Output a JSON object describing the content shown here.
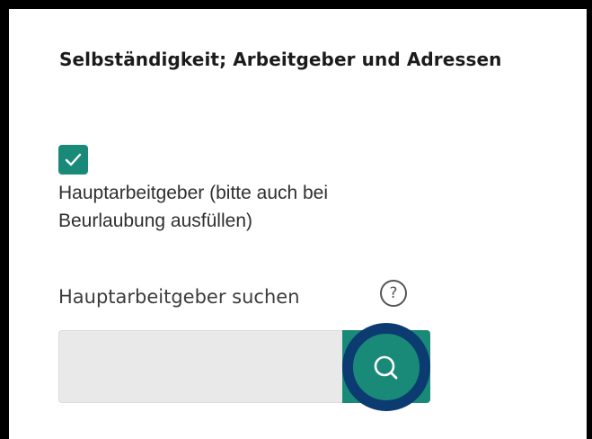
{
  "section": {
    "title": "Selbständigkeit; Arbeitgeber und Adressen"
  },
  "main_employer_checkbox": {
    "checked": true,
    "label": "Hauptarbeitgeber (bitte auch bei Beurlaubung ausfüllen)"
  },
  "employer_search": {
    "label": "Hauptarbeitgeber suchen",
    "help_symbol": "?",
    "input_value": "",
    "button_icon": "search-icon"
  },
  "colors": {
    "accent": "#1a8a78",
    "highlight_ring": "#0b3b71",
    "input_background": "#e9e9e9",
    "frame": "#000000"
  }
}
